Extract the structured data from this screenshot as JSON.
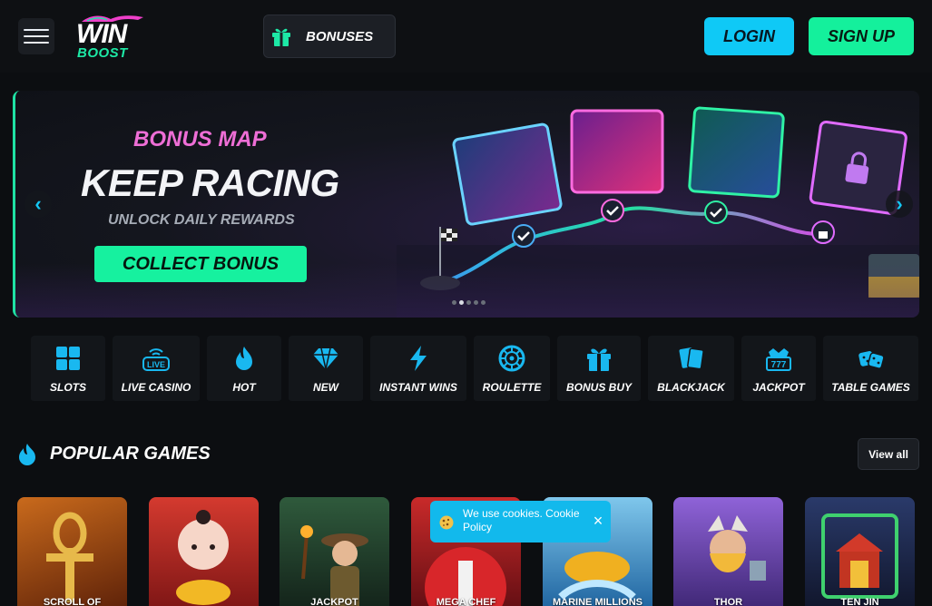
{
  "header": {
    "menu_icon": "hamburger-menu-icon",
    "logo": {
      "line1": "WIN",
      "line2": "BOOST"
    },
    "bonuses_label": "BONUSES",
    "bonuses_icon": "gift-icon",
    "login_label": "LOGIN",
    "signup_label": "SIGN UP",
    "colors": {
      "login": "#0fc9f6",
      "signup": "#14f09c",
      "accent_pink": "#ee6ed6"
    }
  },
  "hero": {
    "subtitle": "BONUS MAP",
    "title": "KEEP RACING",
    "tagline": "UNLOCK DAILY REWARDS",
    "cta_label": "COLLECT BONUS",
    "prev_arrow": "‹",
    "next_arrow": "›",
    "slide_count": 5,
    "active_slide": 2
  },
  "categories": [
    {
      "label": "SLOTS",
      "icon": "slots-grid-icon"
    },
    {
      "label": "LIVE CASINO",
      "icon": "live-casino-icon"
    },
    {
      "label": "HOT",
      "icon": "flame-icon"
    },
    {
      "label": "NEW",
      "icon": "diamond-icon"
    },
    {
      "label": "INSTANT WINS",
      "icon": "lightning-icon"
    },
    {
      "label": "ROULETTE",
      "icon": "roulette-icon"
    },
    {
      "label": "BONUS BUY",
      "icon": "gift-icon"
    },
    {
      "label": "BLACKJACK",
      "icon": "cards-icon"
    },
    {
      "label": "JACKPOT",
      "icon": "jackpot-777-icon"
    },
    {
      "label": "TABLE GAMES",
      "icon": "dice-icon"
    }
  ],
  "popular": {
    "title": "POPULAR GAMES",
    "icon": "flame-icon",
    "view_all_label": "View all",
    "games": [
      {
        "name": "SCROLL OF",
        "bg": "#7a3a10"
      },
      {
        "name": "",
        "bg": "#c1312c"
      },
      {
        "name": "JACKPOT",
        "bg": "#1d4a3a"
      },
      {
        "name": "MEGA CHEF",
        "bg": "#a01f24"
      },
      {
        "name": "MARINE MILLIONS",
        "bg": "#1f7fb9"
      },
      {
        "name": "THOR",
        "bg": "#5b3fa8"
      },
      {
        "name": "TEN JIN",
        "bg": "#1b2740"
      }
    ]
  },
  "cookie": {
    "text": "We use cookies. Cookie Policy",
    "close": "×",
    "icon": "cookie-icon"
  }
}
